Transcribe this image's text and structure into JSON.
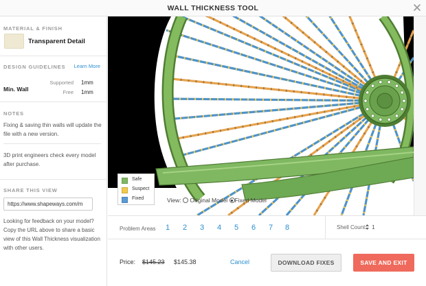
{
  "window": {
    "title": "WALL THICKNESS TOOL"
  },
  "material": {
    "heading": "MATERIAL & FINISH",
    "name": "Transparent Detail",
    "swatch_color": "#efe9d3"
  },
  "guidelines": {
    "heading": "DESIGN GUIDELINES",
    "learn_more": "Learn More",
    "min_wall_label": "Min. Wall",
    "supported_label": "Supported",
    "supported_value": "1mm",
    "free_label": "Free",
    "free_value": "1mm"
  },
  "notes": {
    "heading": "NOTES",
    "note1": "Fixing & saving thin walls will update the file with a new version.",
    "note2": "3D print engineers check every model after purchase."
  },
  "share": {
    "heading": "SHARE THIS VIEW",
    "url": "https://www.shapeways.com/m",
    "description": "Looking for feedback on your model? Copy the URL above to share a basic view of this Wall Thickness visualization with other users."
  },
  "legend": {
    "items": [
      {
        "label": "Safe",
        "color": "#7fb861"
      },
      {
        "label": "Suspect",
        "color": "#f2c94c"
      },
      {
        "label": "Fixed",
        "color": "#5b9bd5"
      }
    ]
  },
  "view": {
    "label": "View:",
    "option_original": "Original Model",
    "option_fixed": "Fixed Model",
    "selected": "Fixed Model"
  },
  "problem_areas": {
    "label": "Problem Areas",
    "numbers": [
      "1",
      "2",
      "3",
      "4",
      "5",
      "6",
      "7",
      "8"
    ]
  },
  "shell": {
    "label": "Shell Count:",
    "value": "1"
  },
  "footer": {
    "price_label": "Price:",
    "price_old": "$145.23",
    "price_new": "$145.38",
    "cancel": "Cancel",
    "download": "DOWNLOAD FIXES",
    "save": "SAVE AND EXIT"
  },
  "colors": {
    "accent": "#2a8fd0",
    "save_button": "#ef6a5c",
    "model_green": "#7fb861",
    "spoke_orange": "#e9a24a",
    "spoke_blue": "#4f93c9"
  }
}
